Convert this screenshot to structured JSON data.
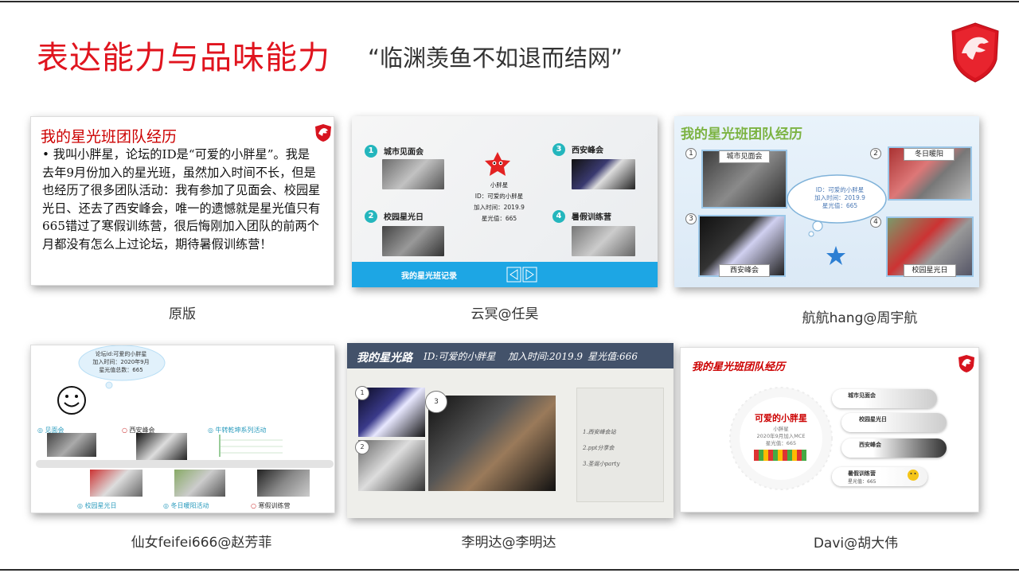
{
  "page": {
    "title": "表达能力与品味能力",
    "subtitle": "“临渊羡鱼不如退而结网”"
  },
  "slides": [
    {
      "caption": "原版",
      "title": "我的星光班团队经历",
      "body": "• 我叫小胖星，论坛的ID是“可爱的小胖星”。我是去年9月份加入的星光班，虽然加入时间不长，但是也经历了很多团队活动：我有参加了见面会、校园星光日、还去了西安峰会，唯一的遗憾就是星光值只有665错过了寒假训练营，很后悔刚加入团队的前两个月都没有怎么上过论坛，期待暑假训练营！"
    },
    {
      "caption": "云冥@任昊",
      "items": [
        {
          "num": "1",
          "label": "城市见面会"
        },
        {
          "num": "2",
          "label": "校园星光日"
        },
        {
          "num": "3",
          "label": "西安峰会"
        },
        {
          "num": "4",
          "label": "暑假训练营"
        }
      ],
      "info": [
        "小胖星",
        "ID：可爱的小胖星",
        "加入时间：2019.9",
        "星光值：665"
      ],
      "bar_text": "我的星光班记录"
    },
    {
      "caption": "航航hang@周宇航",
      "title": "我的星光班团队经历",
      "labels": [
        "城市见面会",
        "冬日暖阳",
        "西安峰会",
        "校园星光日"
      ],
      "nums": [
        "1",
        "2",
        "3",
        "4"
      ],
      "cloud": [
        "ID：可爱的小胖星",
        "加入时间：2019.9",
        "星光值：665"
      ]
    },
    {
      "caption": "仙女feifei666@赵芳菲",
      "cloud": [
        "论坛id:可爱的小胖星",
        "加入时间：2020年9月",
        "星光值总数：665"
      ],
      "labels": [
        "见面会",
        "西安峰会",
        "牛转乾坤系列活动",
        "校园星光日",
        "冬日暖阳活动",
        "寒假训练营"
      ]
    },
    {
      "caption": "李明达@李明达",
      "header": [
        "我的星光路",
        "ID:可爱的小胖星",
        "加入时间:2019.9",
        "星光值:666"
      ],
      "nums": [
        "1",
        "2",
        "3"
      ],
      "list": [
        "1.西安峰会站",
        "2.ppt分享会",
        "3.圣诞小party"
      ]
    },
    {
      "caption": "Davi@胡大伟",
      "title": "我的星光班团队经历",
      "name": "可爱的小胖星",
      "sub": [
        "小胖星",
        "2020年9月加入MCE",
        "星光值：665"
      ],
      "pills": [
        "城市见面会",
        "校园星光日",
        "西安峰会",
        "暑假训练营"
      ],
      "pill_note": "星光值：665"
    }
  ],
  "colors": {
    "title_red": "#e0141e",
    "msi_red": "#d7141f",
    "teal": "#24b6bd",
    "blue_bar": "#1da6e4",
    "navy_header": "#43526a"
  }
}
